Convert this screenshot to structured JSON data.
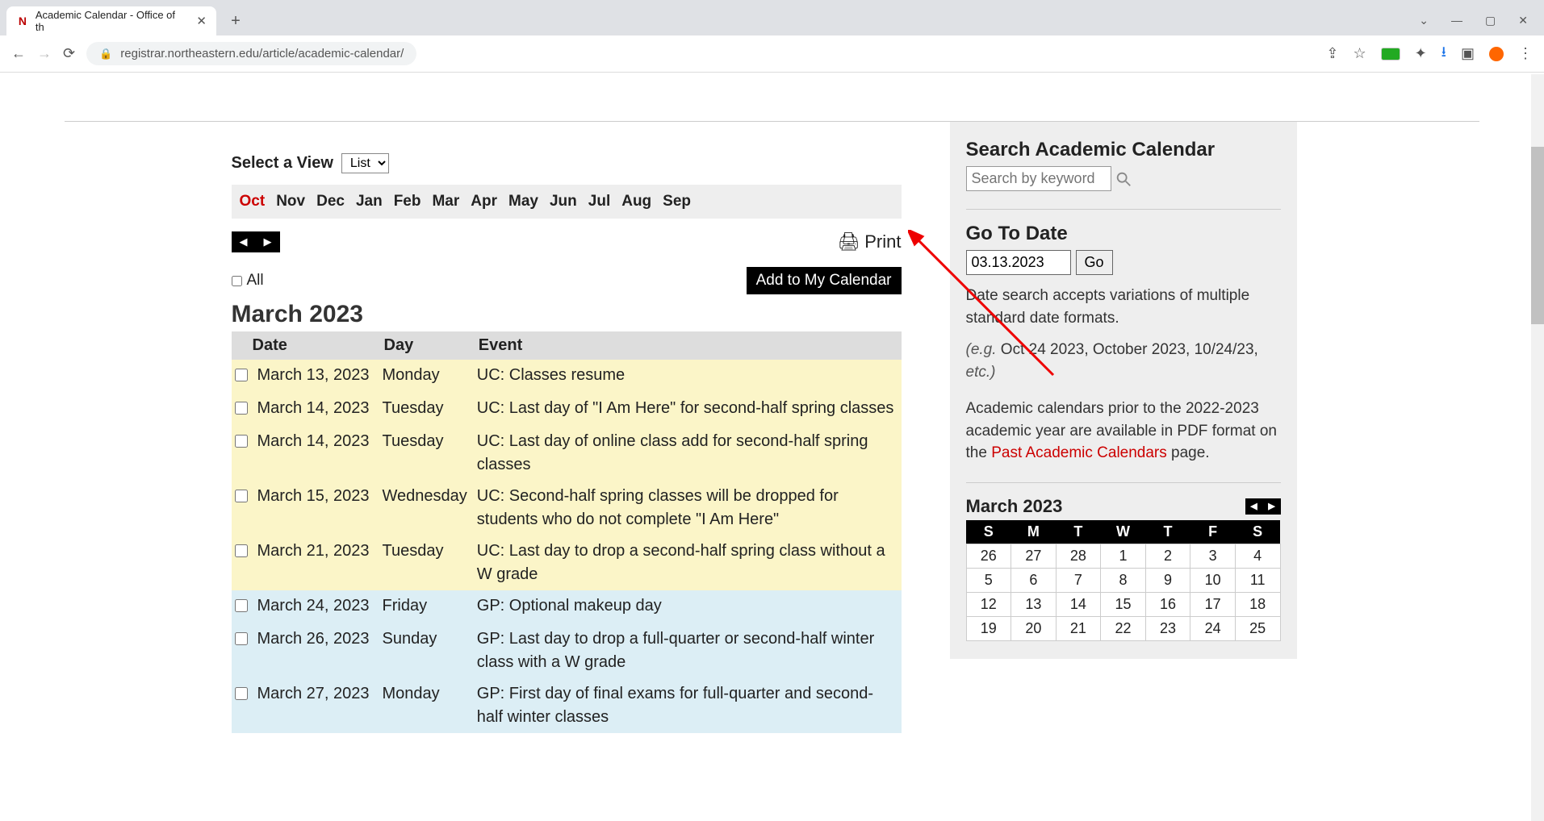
{
  "browser": {
    "tab_title": "Academic Calendar - Office of th",
    "url": "registrar.northeastern.edu/article/academic-calendar/"
  },
  "view": {
    "label": "Select a View",
    "selected": "List"
  },
  "months_nav": [
    "Oct",
    "Nov",
    "Dec",
    "Jan",
    "Feb",
    "Mar",
    "Apr",
    "May",
    "Jun",
    "Jul",
    "Aug",
    "Sep"
  ],
  "months_active": "Oct",
  "print_label": "Print",
  "all_label": "All",
  "add_calendar_label": "Add to My Calendar",
  "heading_month": "March 2023",
  "table_headers": {
    "date": "Date",
    "day": "Day",
    "event": "Event"
  },
  "events": [
    {
      "date": "March 13, 2023",
      "day": "Monday",
      "event": "UC: Classes resume",
      "tone": "yellow"
    },
    {
      "date": "March 14, 2023",
      "day": "Tuesday",
      "event": "UC: Last day of \"I Am Here\" for second-half spring classes",
      "tone": "yellow"
    },
    {
      "date": "March 14, 2023",
      "day": "Tuesday",
      "event": "UC: Last day of online class add for second-half spring classes",
      "tone": "yellow"
    },
    {
      "date": "March 15, 2023",
      "day": "Wednesday",
      "event": "UC: Second-half spring classes will be dropped for students who do not complete \"I Am Here\"",
      "tone": "yellow"
    },
    {
      "date": "March 21, 2023",
      "day": "Tuesday",
      "event": "UC: Last day to drop a second-half spring class without a W grade",
      "tone": "yellow"
    },
    {
      "date": "March 24, 2023",
      "day": "Friday",
      "event": "GP: Optional makeup day",
      "tone": "blue"
    },
    {
      "date": "March 26, 2023",
      "day": "Sunday",
      "event": "GP: Last day to drop a full-quarter or second-half winter class with a W grade",
      "tone": "blue"
    },
    {
      "date": "March 27, 2023",
      "day": "Monday",
      "event": "GP: First day of final exams for full-quarter and second-half winter classes",
      "tone": "blue"
    }
  ],
  "search": {
    "heading": "Search Academic Calendar",
    "placeholder": "Search by keyword"
  },
  "goto": {
    "heading": "Go To Date",
    "value": "03.13.2023",
    "button": "Go",
    "help1": "Date search accepts variations of multiple standard date formats.",
    "help2_prefix": "(e.g.",
    "help2_body": " Oct 24 2023, October 2023, 10/24/23, ",
    "help2_suffix": "etc.)",
    "note_pre": "Academic calendars prior to the 2022-2023 academic year are available in PDF format on the ",
    "note_link": "Past Academic Calendars",
    "note_post": " page."
  },
  "minical": {
    "title": "March 2023",
    "dow": [
      "S",
      "M",
      "T",
      "W",
      "T",
      "F",
      "S"
    ],
    "rows": [
      [
        "26",
        "27",
        "28",
        "1",
        "2",
        "3",
        "4"
      ],
      [
        "5",
        "6",
        "7",
        "8",
        "9",
        "10",
        "11"
      ],
      [
        "12",
        "13",
        "14",
        "15",
        "16",
        "17",
        "18"
      ],
      [
        "19",
        "20",
        "21",
        "22",
        "23",
        "24",
        "25"
      ]
    ]
  }
}
